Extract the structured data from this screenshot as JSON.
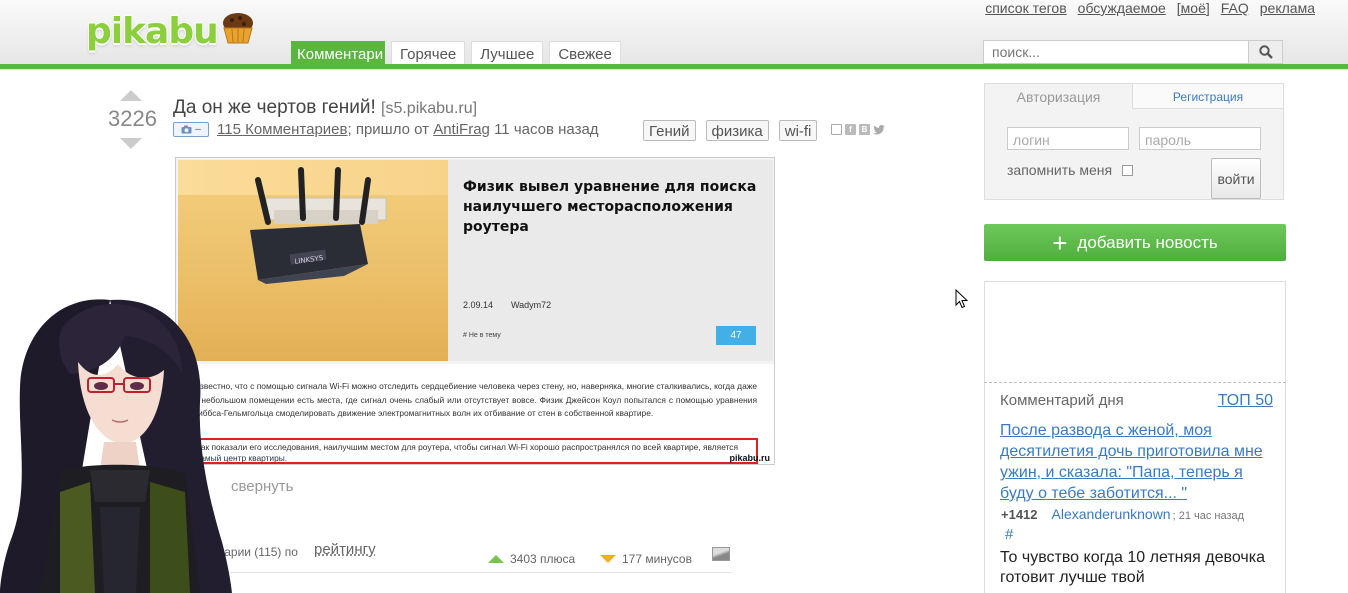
{
  "header": {
    "logo_text": "pikabu",
    "top_links": [
      "список тегов",
      "обсуждаемое",
      "[моё]",
      "FAQ",
      "реклама"
    ],
    "tabs": [
      {
        "label": "Комментари",
        "active": true
      },
      {
        "label": "Горячее",
        "active": false
      },
      {
        "label": "Лучшее",
        "active": false
      },
      {
        "label": "Свежее",
        "active": false
      }
    ],
    "search_placeholder": "поиск..."
  },
  "post": {
    "rating": "3226",
    "title": "Да он же чертов гений!",
    "source": "[s5.pikabu.ru]",
    "comments_link": "115 Комментариев",
    "meta_mid": "; пришло от",
    "author": "AntiFrag",
    "time": "11 часов назад",
    "badge_minus": "–",
    "tags": [
      "Гений",
      "физика",
      "wi-fi"
    ],
    "article": {
      "headline": "Физик вывел уравнение для поиска наилучшего месторасположения роутера",
      "date": "2.09.14",
      "author": "Wadym72",
      "small": "# Не в тему",
      "count": "47",
      "paragraph": "Известно, что с помощью сигнала Wi-Fi можно отследить сердцебиение человека через стену, но, наверняка, многие сталкивались, когда даже в небольшом помещении есть места, где сигнал очень слабый или отсутствует вовсе. Физик Джейсон Коул попытался с помощью уравнения Гиббса-Гельмгольца смоделировать движение электромагнитных волн их отбивание от стен в собственной квартире.",
      "highlight": "Как показали его исследования, наилучшим местом для роутера, чтобы сигнал Wi-Fi хорошо распространялся по всей квартире, является самый центр квартиры.",
      "watermark": "pikabu.ru",
      "router_brand": "LINKSYS"
    },
    "collapse": "свернуть",
    "comments_label": "комментарии (115) по",
    "sort_by": "рейтингу",
    "plus": "3403 плюса",
    "minus": "177 минусов"
  },
  "sidebar": {
    "auth_tab": "Авторизация",
    "register_tab": "Регистрация",
    "login_placeholder": "логин",
    "password_placeholder": "пароль",
    "remember": "запомнить меня",
    "login_button": "войти",
    "add_news": "добавить новость",
    "comment_of_day": "Комментарий дня",
    "top50": "ТОП 50",
    "cod_link": "После развода с женой, моя десятилетия дочь приготовила мне ужин, и сказала: \"Папа, теперь я буду о тебе заботится... \"",
    "cod_score": "+1412",
    "cod_user": "Alexanderunknown",
    "cod_time": "; 21 час назад",
    "cod_hash": "#",
    "cod_text": "То чувство когда 10 летняя девочка готовит лучше твой"
  },
  "colors": {
    "brand_green": "#5bb640",
    "link_blue": "#3a7bbf",
    "highlight_red": "#e02020",
    "count_blue": "#42b0e6"
  }
}
